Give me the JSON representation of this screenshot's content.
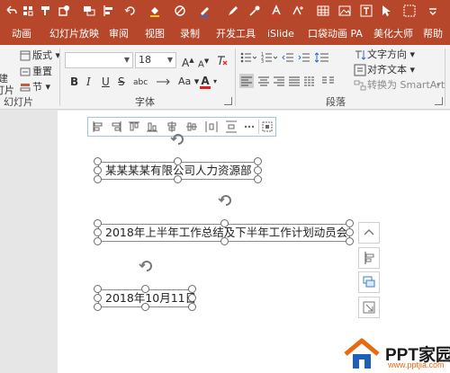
{
  "ribbon_tabs": [
    "动画",
    "幻灯片放映",
    "审阅",
    "视图",
    "录制",
    "开发工具",
    "iSlide",
    "口袋动画 PA",
    "美化大师",
    "帮助"
  ],
  "ribbon": {
    "slides_group": {
      "partial_new": "建",
      "partial_new2": "灯片",
      "layout": "版式",
      "reset": "重置",
      "section": "节",
      "label": "幻灯片"
    },
    "font_group": {
      "font_name": "",
      "font_size": "18",
      "bold": "B",
      "italic": "I",
      "underline": "U",
      "strike": "S",
      "spacing": "abc",
      "grow": "A",
      "shrink": "A",
      "font_color": "A",
      "label": "字体"
    },
    "paragraph_group": {
      "text_direction": "文字方向",
      "align_text": "对齐文本",
      "convert_smartart": "转换为 SmartArt",
      "label": "段落"
    }
  },
  "slide": {
    "textboxes": [
      {
        "text": "某某某某有限公司人力资源部"
      },
      {
        "text": "2018年上半年工作总结及下半年工作计划动员会"
      },
      {
        "text": "2018年10月11日"
      }
    ]
  },
  "watermark": {
    "brand": "PPT家园",
    "url": "www.pptjia.com"
  },
  "colors": {
    "accent": "#b7472a",
    "ribbon_bg": "#f3f3f3",
    "selection_border": "#8a8a8a"
  }
}
